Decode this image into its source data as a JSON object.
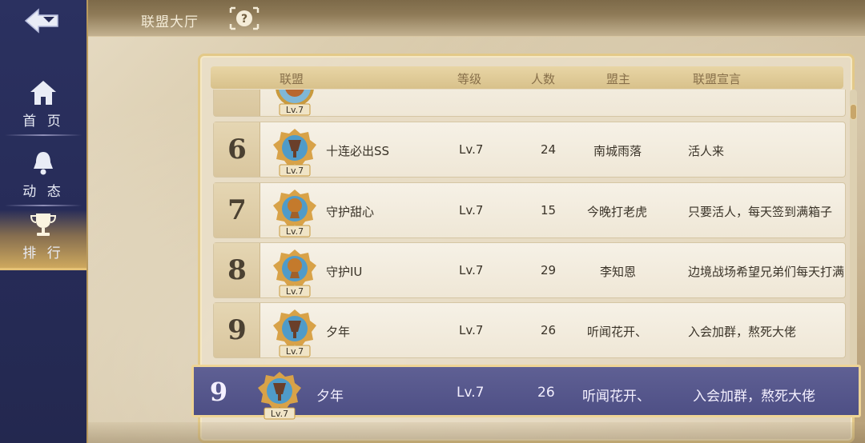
{
  "header": {
    "title": "联盟大厅"
  },
  "sidebar": {
    "items": [
      {
        "label": "首 页",
        "icon": "home-icon"
      },
      {
        "label": "动 态",
        "icon": "bell-icon"
      },
      {
        "label": "排 行",
        "icon": "trophy-icon",
        "active": true
      }
    ]
  },
  "table": {
    "columns": [
      "联盟",
      "等级",
      "人数",
      "盟主",
      "联盟宣言"
    ],
    "partial_row": {
      "level_badge": "Lv.7"
    },
    "rows": [
      {
        "rank": "6",
        "name": "十连必出SS",
        "level": "Lv.7",
        "members": "24",
        "leader": "南城雨落",
        "declaration": "活人来",
        "badge": "Lv.7"
      },
      {
        "rank": "7",
        "name": "守护甜心",
        "level": "Lv.7",
        "members": "15",
        "leader": "今晚打老虎",
        "declaration": "只要活人，每天签到满箱子",
        "badge": "Lv.7"
      },
      {
        "rank": "8",
        "name": "守护IU",
        "level": "Lv.7",
        "members": "29",
        "leader": "李知恩",
        "declaration": "边境战场希望兄弟们每天打满!",
        "badge": "Lv.7"
      },
      {
        "rank": "9",
        "name": "夕年",
        "level": "Lv.7",
        "members": "26",
        "leader": "听闻花开、",
        "declaration": "入会加群，熬死大佬",
        "badge": "Lv.7"
      }
    ]
  },
  "my_alliance": {
    "rank": "9",
    "name": "夕年",
    "level": "Lv.7",
    "members": "26",
    "leader": "听闻花开、",
    "declaration": "入会加群，熬死大佬",
    "badge": "Lv.7"
  },
  "colors": {
    "sidebar_bg": "#262b57",
    "active_tab": "#e4c176",
    "my_row_bg": "#55568b",
    "panel_border": "#e3c988"
  }
}
